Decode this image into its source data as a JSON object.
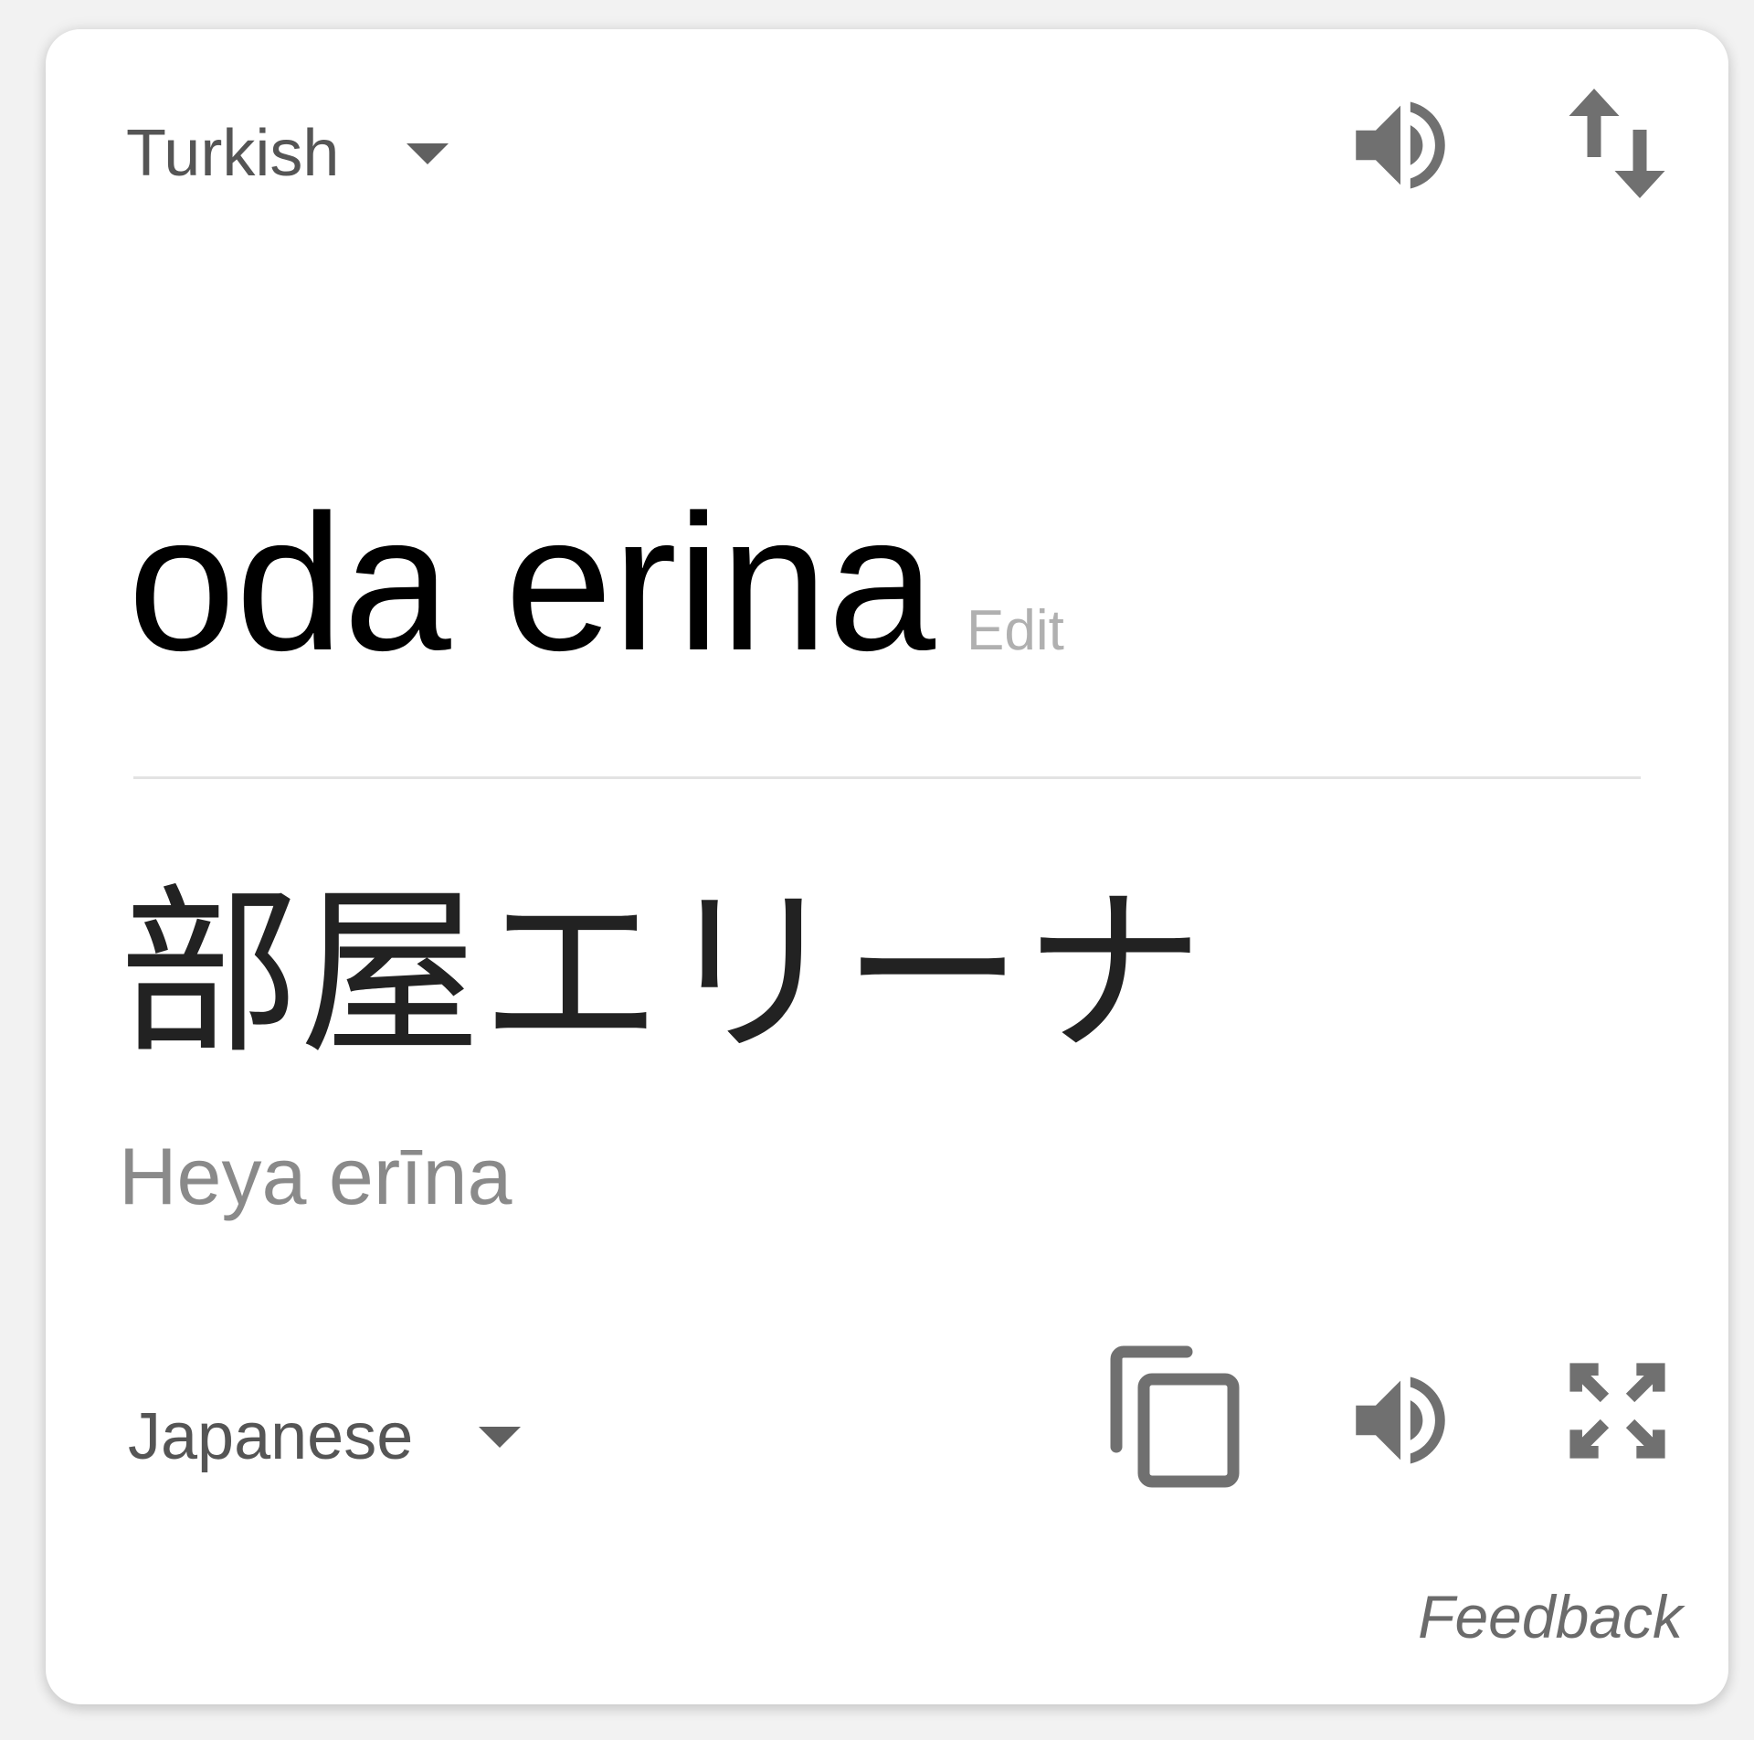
{
  "source": {
    "language": "Turkish",
    "text": "oda erina",
    "edit_label": "Edit",
    "icons": {
      "listen": "speaker-icon",
      "swap": "swap-languages-icon",
      "dropdown": "caret-down-icon"
    }
  },
  "target": {
    "language": "Japanese",
    "text": "部屋エリーナ",
    "romanization": "Heya erīna",
    "icons": {
      "copy": "copy-icon",
      "listen": "speaker-icon",
      "expand": "fullscreen-icon",
      "dropdown": "caret-down-icon"
    }
  },
  "feedback_label": "Feedback",
  "colors": {
    "icon": "#707070",
    "source_text": "#000000",
    "target_text": "#222222",
    "muted": "#8a8a8a",
    "divider": "#e3e3e3"
  }
}
